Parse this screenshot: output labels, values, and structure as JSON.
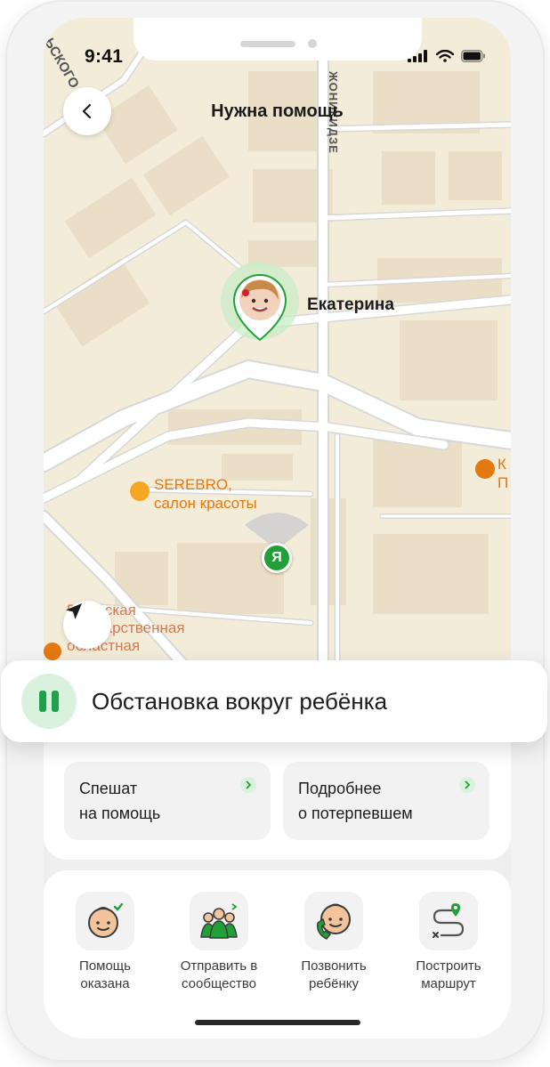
{
  "status_bar": {
    "time": "9:41"
  },
  "header": {
    "title": "Нужна помощь"
  },
  "map": {
    "street_vertical": "ЖОНИКИДЗЕ",
    "street_corner": "ЬСКОГО",
    "child_name": "Екатерина",
    "me_marker": "Я",
    "poi_salon": "SEREBRO,\nсалон красоты",
    "poi_library": "Пермская\nгосударственная\nобластная\nюношая",
    "poi_right": "К\nП"
  },
  "banner": {
    "label": "Обстановка вокруг ребёнка"
  },
  "actions": [
    {
      "label": "Спешат\nна помощь"
    },
    {
      "label": "Подробнее\nо потерпевшем"
    }
  ],
  "tools": [
    {
      "label": "Помощь\nоказана",
      "icon": "child-check-icon"
    },
    {
      "label": "Отправить в\nсообщество",
      "icon": "community-share-icon"
    },
    {
      "label": "Позвонить\nребёнку",
      "icon": "child-call-icon"
    },
    {
      "label": "Построить\nмаршрут",
      "icon": "route-icon"
    }
  ],
  "colors": {
    "accent": "#21a038",
    "accent_light": "#d8f2dd",
    "map_bg": "#f3ecd9",
    "poi": "#e5780f"
  }
}
